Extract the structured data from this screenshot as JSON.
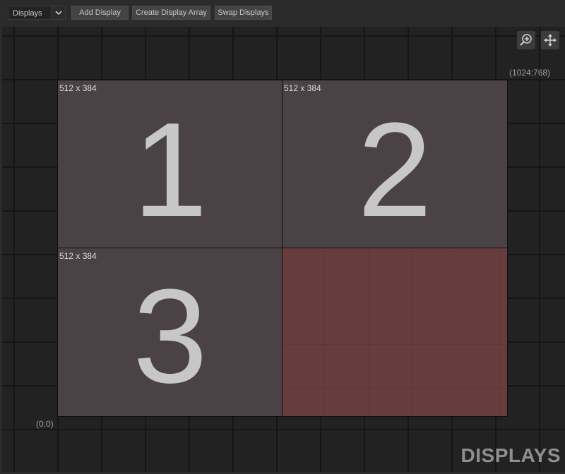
{
  "toolbar": {
    "mode_select": {
      "value": "Displays"
    },
    "buttons": {
      "add_display": "Add Display",
      "create_array": "Create Display Array",
      "swap_displays": "Swap Displays"
    }
  },
  "canvas": {
    "icons": {
      "zoom": "zoom-in-icon",
      "move": "move-icon"
    },
    "max_coordinate": "(1024:768)",
    "origin_coordinate": "(0:0)",
    "watermark": "DISPLAYS",
    "displays": [
      {
        "number": "1",
        "size": "512 x 384"
      },
      {
        "number": "2",
        "size": "512 x 384"
      },
      {
        "number": "3",
        "size": "512 x 384"
      }
    ],
    "colors": {
      "display_fill": "#4a4245",
      "empty_slot_fill": "#663d3c",
      "canvas_bg": "#222222",
      "toolbar_bg": "#2b2b2b"
    }
  }
}
